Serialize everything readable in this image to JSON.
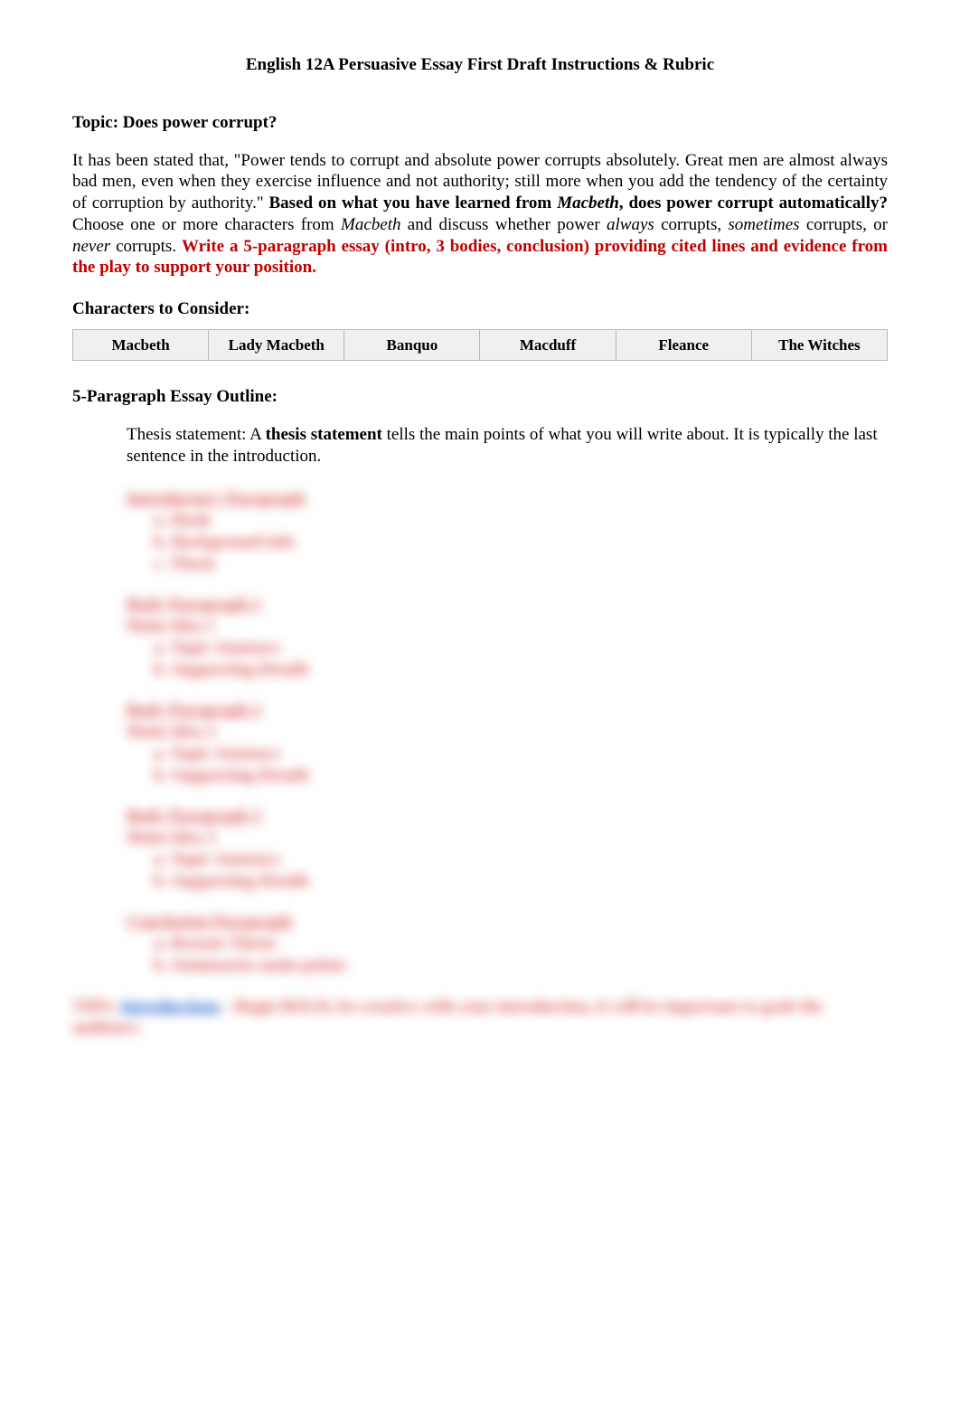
{
  "title": "English 12A Persuasive Essay First Draft Instructions & Rubric",
  "topic": {
    "label": "Topic: Does power corrupt?"
  },
  "prompt": {
    "p1_a": "It has been stated that, \"Power tends to corrupt and absolute power corrupts absolutely. Great men are almost always bad men, even when they exercise influence and not authority; still more when you add the tendency of the certainty of corruption by authority.\" ",
    "p1_b": "Based on what you have learned from ",
    "p1_c": "Macbeth",
    "p1_d": ", does power corrupt automatically?",
    "p1_e": " Choose one or more characters from ",
    "p1_f": "Macbeth",
    "p1_g": " and discuss whether power ",
    "p1_h": "always",
    "p1_i": " corrupts, ",
    "p1_j": "sometimes",
    "p1_k": " corrupts, or ",
    "p1_l": "never",
    "p1_m": " corrupts. ",
    "p1_n": "Write a 5-paragraph essay (intro, 3 bodies, conclusion) providing cited lines and evidence from the play to support your position."
  },
  "characters": {
    "heading": "Characters to Consider:",
    "list": [
      "Macbeth",
      "Lady Macbeth",
      "Banquo",
      "Macduff",
      "Fleance",
      "The Witches"
    ]
  },
  "outline": {
    "heading": "5-Paragraph Essay Outline:",
    "thesis_a": "Thesis statement: A ",
    "thesis_b": "thesis statement",
    "thesis_c": " tells the main points of what you will write about. It is typically the last sentence in the introduction."
  },
  "blurred": {
    "intro": {
      "title": "Introductory Paragraph",
      "a": "a.  Hook",
      "b": "b.  Background info",
      "c": "c.  Thesis"
    },
    "body1": {
      "title": "Body Paragraph 1",
      "sub": "Main Idea 1",
      "a": "a.  Topic Sentence",
      "b": "b.  Supporting Details"
    },
    "body2": {
      "title": "Body Paragraph 2",
      "sub": "Main Idea 2",
      "a": "a.  Topic Sentence",
      "b": "b.  Supporting Details"
    },
    "body3": {
      "title": "Body Paragraph 3",
      "sub": "Main Idea 3",
      "a": "a.  Topic Sentence",
      "b": "b.  Supporting Details"
    },
    "conclusion": {
      "title": "Conclusion Paragraph",
      "a": "a.  Restate Thesis",
      "b": "b.  Summarize main points"
    },
    "footer_a": "TIPS: ",
    "footer_link": "Introductions",
    "footer_b": " - Begin BOLD, be creative with your introduction, it will be important to grab the audience."
  }
}
